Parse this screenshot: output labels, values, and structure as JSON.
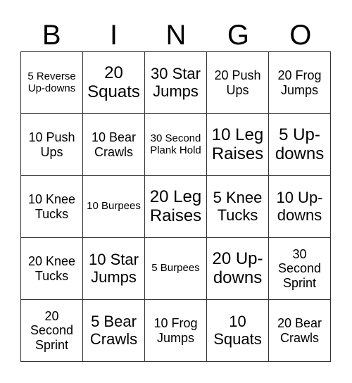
{
  "header": [
    "B",
    "I",
    "N",
    "G",
    "O"
  ],
  "cells": [
    {
      "text": "5 Reverse Up-downs",
      "size": "sm"
    },
    {
      "text": "20 Squats",
      "size": "xl"
    },
    {
      "text": "30 Star Jumps",
      "size": "lg"
    },
    {
      "text": "20 Push Ups",
      "size": "md"
    },
    {
      "text": "20 Frog Jumps",
      "size": "md"
    },
    {
      "text": "10 Push Ups",
      "size": "md"
    },
    {
      "text": "10 Bear Crawls",
      "size": "md"
    },
    {
      "text": "30 Second Plank Hold",
      "size": "sm"
    },
    {
      "text": "10 Leg Raises",
      "size": "xl"
    },
    {
      "text": "5 Up-downs",
      "size": "xl"
    },
    {
      "text": "10 Knee Tucks",
      "size": "md"
    },
    {
      "text": "10 Burpees",
      "size": "sm"
    },
    {
      "text": "20 Leg Raises",
      "size": "xl"
    },
    {
      "text": "5 Knee Tucks",
      "size": "lg"
    },
    {
      "text": "10 Up-downs",
      "size": "lg"
    },
    {
      "text": "20 Knee Tucks",
      "size": "md"
    },
    {
      "text": "10 Star Jumps",
      "size": "lg"
    },
    {
      "text": "5 Burpees",
      "size": "sm"
    },
    {
      "text": "20 Up-downs",
      "size": "xl"
    },
    {
      "text": "30 Second Sprint",
      "size": "md"
    },
    {
      "text": "20 Second Sprint",
      "size": "md"
    },
    {
      "text": "5 Bear Crawls",
      "size": "lg"
    },
    {
      "text": "10 Frog Jumps",
      "size": "md"
    },
    {
      "text": "10 Squats",
      "size": "lg"
    },
    {
      "text": "20 Bear Crawls",
      "size": "md"
    }
  ]
}
